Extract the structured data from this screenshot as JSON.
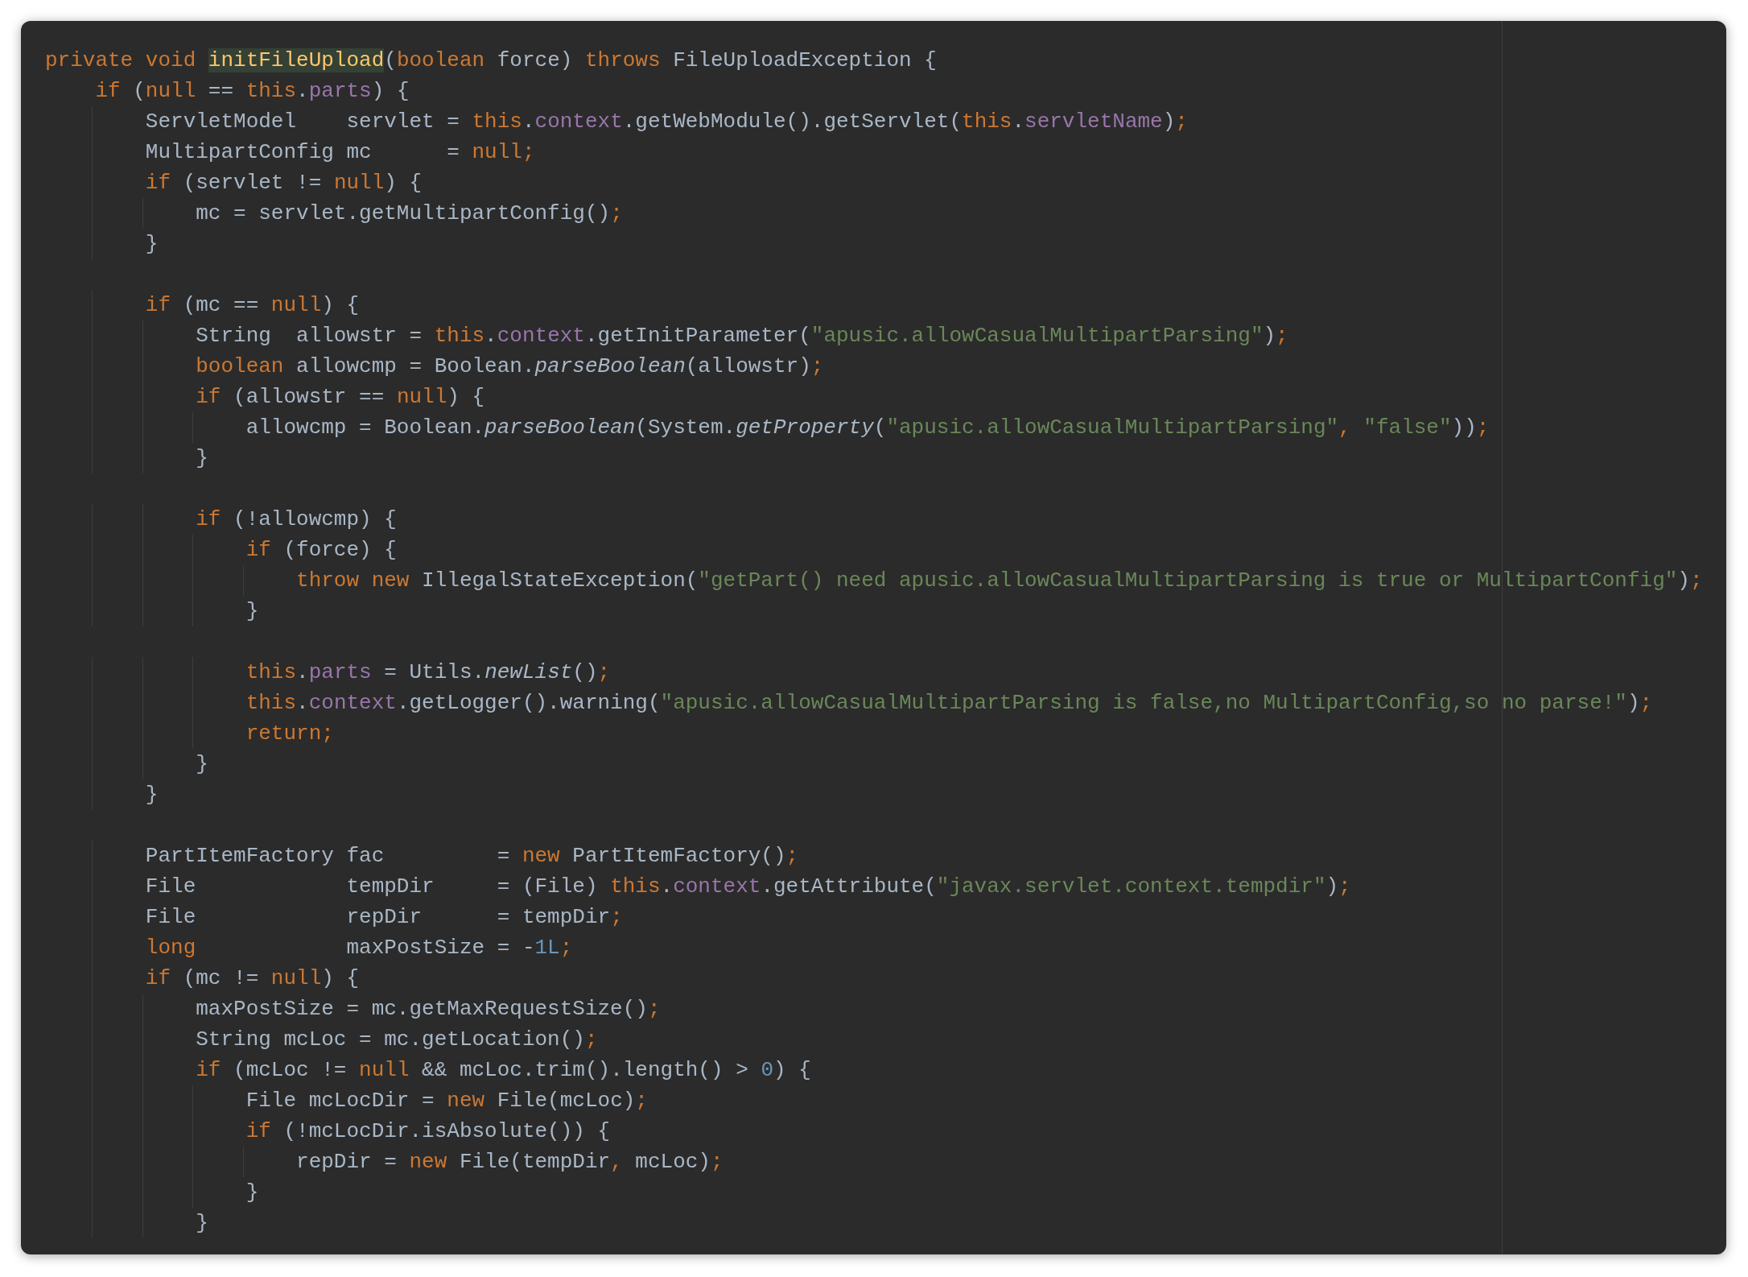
{
  "editor": {
    "lines": [
      {
        "kind": "code",
        "tokens": [
          {
            "kind": "keyword",
            "text": "private void "
          },
          {
            "kind": "declaration",
            "text": "initFileUpload"
          },
          {
            "kind": "plain",
            "text": "("
          },
          {
            "kind": "keyword",
            "text": "boolean "
          },
          {
            "kind": "plain",
            "text": "force) "
          },
          {
            "kind": "keyword",
            "text": "throws "
          },
          {
            "kind": "plain",
            "text": "FileUploadException {"
          }
        ]
      },
      {
        "kind": "code",
        "tokens": [
          {
            "kind": "keyword",
            "text": "    if "
          },
          {
            "kind": "plain",
            "text": "("
          },
          {
            "kind": "keyword",
            "text": "null "
          },
          {
            "kind": "plain",
            "text": "== "
          },
          {
            "kind": "keyword",
            "text": "this"
          },
          {
            "kind": "plain",
            "text": "."
          },
          {
            "kind": "field",
            "text": "parts"
          },
          {
            "kind": "plain",
            "text": ") {"
          }
        ]
      },
      {
        "kind": "code",
        "tokens": [
          {
            "kind": "plain",
            "text": "        ServletModel    servlet = "
          },
          {
            "kind": "keyword",
            "text": "this"
          },
          {
            "kind": "plain",
            "text": "."
          },
          {
            "kind": "field",
            "text": "context"
          },
          {
            "kind": "plain",
            "text": ".getWebModule().getServlet("
          },
          {
            "kind": "keyword",
            "text": "this"
          },
          {
            "kind": "plain",
            "text": "."
          },
          {
            "kind": "field",
            "text": "servletName"
          },
          {
            "kind": "plain",
            "text": ")"
          },
          {
            "kind": "keyword",
            "text": ";"
          }
        ]
      },
      {
        "kind": "code",
        "tokens": [
          {
            "kind": "plain",
            "text": "        MultipartConfig mc      = "
          },
          {
            "kind": "keyword",
            "text": "null;"
          }
        ]
      },
      {
        "kind": "code",
        "tokens": [
          {
            "kind": "keyword",
            "text": "        if "
          },
          {
            "kind": "plain",
            "text": "(servlet != "
          },
          {
            "kind": "keyword",
            "text": "null"
          },
          {
            "kind": "plain",
            "text": ") {"
          }
        ]
      },
      {
        "kind": "code",
        "tokens": [
          {
            "kind": "plain",
            "text": "            mc = servlet.getMultipartConfig()"
          },
          {
            "kind": "keyword",
            "text": ";"
          }
        ]
      },
      {
        "kind": "code",
        "tokens": [
          {
            "kind": "plain",
            "text": "        }"
          }
        ]
      },
      {
        "kind": "blank"
      },
      {
        "kind": "code",
        "tokens": [
          {
            "kind": "keyword",
            "text": "        if "
          },
          {
            "kind": "plain",
            "text": "(mc == "
          },
          {
            "kind": "keyword",
            "text": "null"
          },
          {
            "kind": "plain",
            "text": ") {"
          }
        ]
      },
      {
        "kind": "code",
        "tokens": [
          {
            "kind": "plain",
            "text": "            String  allowstr = "
          },
          {
            "kind": "keyword",
            "text": "this"
          },
          {
            "kind": "plain",
            "text": "."
          },
          {
            "kind": "field",
            "text": "context"
          },
          {
            "kind": "plain",
            "text": ".getInitParameter("
          },
          {
            "kind": "string",
            "text": "\"apusic.allowCasualMultipartParsing\""
          },
          {
            "kind": "plain",
            "text": ")"
          },
          {
            "kind": "keyword",
            "text": ";"
          }
        ]
      },
      {
        "kind": "code",
        "tokens": [
          {
            "kind": "keyword",
            "text": "            boolean "
          },
          {
            "kind": "plain",
            "text": "allowcmp = Boolean."
          },
          {
            "kind": "static",
            "text": "parseBoolean"
          },
          {
            "kind": "plain",
            "text": "(allowstr)"
          },
          {
            "kind": "keyword",
            "text": ";"
          }
        ]
      },
      {
        "kind": "code",
        "tokens": [
          {
            "kind": "keyword",
            "text": "            if "
          },
          {
            "kind": "plain",
            "text": "(allowstr == "
          },
          {
            "kind": "keyword",
            "text": "null"
          },
          {
            "kind": "plain",
            "text": ") {"
          }
        ]
      },
      {
        "kind": "code",
        "tokens": [
          {
            "kind": "plain",
            "text": "                allowcmp = Boolean."
          },
          {
            "kind": "static",
            "text": "parseBoolean"
          },
          {
            "kind": "plain",
            "text": "(System."
          },
          {
            "kind": "static",
            "text": "getProperty"
          },
          {
            "kind": "plain",
            "text": "("
          },
          {
            "kind": "string",
            "text": "\"apusic.allowCasualMultipartParsing\""
          },
          {
            "kind": "keyword",
            "text": ", "
          },
          {
            "kind": "string",
            "text": "\"false\""
          },
          {
            "kind": "plain",
            "text": "))"
          },
          {
            "kind": "keyword",
            "text": ";"
          }
        ]
      },
      {
        "kind": "code",
        "tokens": [
          {
            "kind": "plain",
            "text": "            }"
          }
        ]
      },
      {
        "kind": "blank"
      },
      {
        "kind": "code",
        "tokens": [
          {
            "kind": "keyword",
            "text": "            if "
          },
          {
            "kind": "plain",
            "text": "(!allowcmp) {"
          }
        ]
      },
      {
        "kind": "code",
        "tokens": [
          {
            "kind": "keyword",
            "text": "                if "
          },
          {
            "kind": "plain",
            "text": "(force) {"
          }
        ]
      },
      {
        "kind": "code",
        "tokens": [
          {
            "kind": "keyword",
            "text": "                    throw new "
          },
          {
            "kind": "plain",
            "text": "IllegalStateException("
          },
          {
            "kind": "string",
            "text": "\"getPart() need apusic.allowCasualMultipartParsing is true or MultipartConfig\""
          },
          {
            "kind": "plain",
            "text": ")"
          },
          {
            "kind": "keyword",
            "text": ";"
          }
        ]
      },
      {
        "kind": "code",
        "tokens": [
          {
            "kind": "plain",
            "text": "                }"
          }
        ]
      },
      {
        "kind": "blank"
      },
      {
        "kind": "code",
        "tokens": [
          {
            "kind": "keyword",
            "text": "                this"
          },
          {
            "kind": "plain",
            "text": "."
          },
          {
            "kind": "field",
            "text": "parts"
          },
          {
            "kind": "plain",
            "text": " = Utils."
          },
          {
            "kind": "static",
            "text": "newList"
          },
          {
            "kind": "plain",
            "text": "()"
          },
          {
            "kind": "keyword",
            "text": ";"
          }
        ]
      },
      {
        "kind": "code",
        "tokens": [
          {
            "kind": "keyword",
            "text": "                this"
          },
          {
            "kind": "plain",
            "text": "."
          },
          {
            "kind": "field",
            "text": "context"
          },
          {
            "kind": "plain",
            "text": ".getLogger().warning("
          },
          {
            "kind": "string",
            "text": "\"apusic.allowCasualMultipartParsing is false,no MultipartConfig,so no parse!\""
          },
          {
            "kind": "plain",
            "text": ")"
          },
          {
            "kind": "keyword",
            "text": ";"
          }
        ]
      },
      {
        "kind": "code",
        "tokens": [
          {
            "kind": "keyword",
            "text": "                return;"
          }
        ]
      },
      {
        "kind": "code",
        "tokens": [
          {
            "kind": "plain",
            "text": "            }"
          }
        ]
      },
      {
        "kind": "code",
        "tokens": [
          {
            "kind": "plain",
            "text": "        }"
          }
        ]
      },
      {
        "kind": "blank"
      },
      {
        "kind": "code",
        "tokens": [
          {
            "kind": "plain",
            "text": "        PartItemFactory fac         = "
          },
          {
            "kind": "keyword",
            "text": "new "
          },
          {
            "kind": "plain",
            "text": "PartItemFactory()"
          },
          {
            "kind": "keyword",
            "text": ";"
          }
        ]
      },
      {
        "kind": "code",
        "tokens": [
          {
            "kind": "plain",
            "text": "        File            tempDir     = (File) "
          },
          {
            "kind": "keyword",
            "text": "this"
          },
          {
            "kind": "plain",
            "text": "."
          },
          {
            "kind": "field",
            "text": "context"
          },
          {
            "kind": "plain",
            "text": ".getAttribute("
          },
          {
            "kind": "string",
            "text": "\"javax.servlet.context.tempdir\""
          },
          {
            "kind": "plain",
            "text": ")"
          },
          {
            "kind": "keyword",
            "text": ";"
          }
        ]
      },
      {
        "kind": "code",
        "tokens": [
          {
            "kind": "plain",
            "text": "        File            repDir      = tempDir"
          },
          {
            "kind": "keyword",
            "text": ";"
          }
        ]
      },
      {
        "kind": "code",
        "tokens": [
          {
            "kind": "keyword",
            "text": "        long            "
          },
          {
            "kind": "plain",
            "text": "maxPostSize = -"
          },
          {
            "kind": "number",
            "text": "1L"
          },
          {
            "kind": "keyword",
            "text": ";"
          }
        ]
      },
      {
        "kind": "code",
        "tokens": [
          {
            "kind": "keyword",
            "text": "        if "
          },
          {
            "kind": "plain",
            "text": "(mc != "
          },
          {
            "kind": "keyword",
            "text": "null"
          },
          {
            "kind": "plain",
            "text": ") {"
          }
        ]
      },
      {
        "kind": "code",
        "tokens": [
          {
            "kind": "plain",
            "text": "            maxPostSize = mc.getMaxRequestSize()"
          },
          {
            "kind": "keyword",
            "text": ";"
          }
        ]
      },
      {
        "kind": "code",
        "tokens": [
          {
            "kind": "plain",
            "text": "            String mcLoc = mc.getLocation()"
          },
          {
            "kind": "keyword",
            "text": ";"
          }
        ]
      },
      {
        "kind": "code",
        "tokens": [
          {
            "kind": "keyword",
            "text": "            if "
          },
          {
            "kind": "plain",
            "text": "(mcLoc != "
          },
          {
            "kind": "keyword",
            "text": "null "
          },
          {
            "kind": "plain",
            "text": "&& mcLoc.trim().length() > "
          },
          {
            "kind": "number",
            "text": "0"
          },
          {
            "kind": "plain",
            "text": ") {"
          }
        ]
      },
      {
        "kind": "code",
        "tokens": [
          {
            "kind": "plain",
            "text": "                File mcLocDir = "
          },
          {
            "kind": "keyword",
            "text": "new "
          },
          {
            "kind": "plain",
            "text": "File(mcLoc)"
          },
          {
            "kind": "keyword",
            "text": ";"
          }
        ]
      },
      {
        "kind": "code",
        "tokens": [
          {
            "kind": "keyword",
            "text": "                if "
          },
          {
            "kind": "plain",
            "text": "(!mcLocDir.isAbsolute()) {"
          }
        ]
      },
      {
        "kind": "code",
        "tokens": [
          {
            "kind": "plain",
            "text": "                    repDir = "
          },
          {
            "kind": "keyword",
            "text": "new "
          },
          {
            "kind": "plain",
            "text": "File(tempDir"
          },
          {
            "kind": "keyword",
            "text": ", "
          },
          {
            "kind": "plain",
            "text": "mcLoc)"
          },
          {
            "kind": "keyword",
            "text": ";"
          }
        ]
      },
      {
        "kind": "code",
        "tokens": [
          {
            "kind": "plain",
            "text": "                }"
          }
        ]
      },
      {
        "kind": "code",
        "tokens": [
          {
            "kind": "plain",
            "text": "            }"
          }
        ]
      }
    ]
  }
}
